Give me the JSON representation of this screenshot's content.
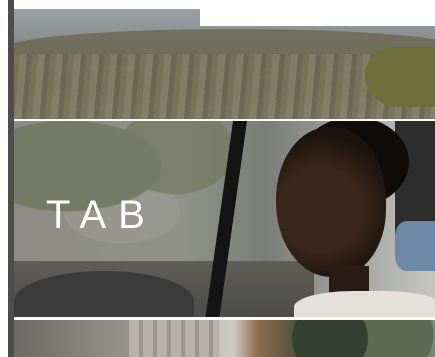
{
  "overlay": {
    "title": "TAB"
  },
  "colors": {
    "rail": "#4d4d4d",
    "background": "#ffffff",
    "overlay_text": "#ffffff"
  }
}
